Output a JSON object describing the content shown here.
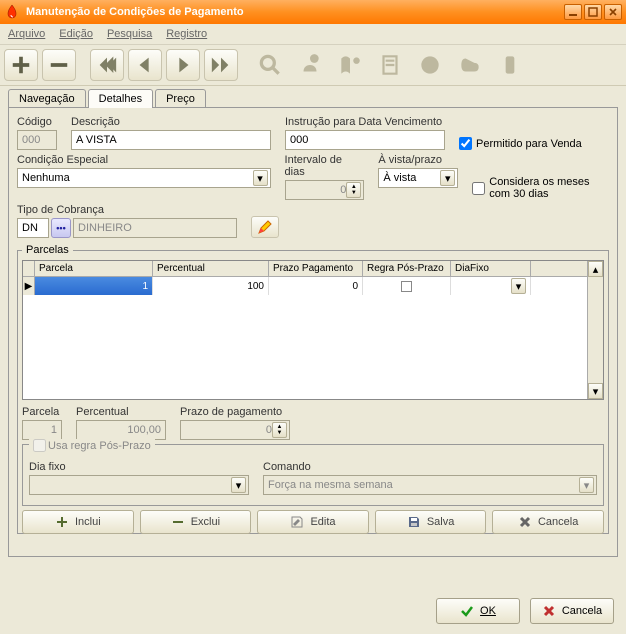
{
  "window": {
    "title": "Manutenção de Condições de Pagamento"
  },
  "menu": {
    "arquivo": "Arquivo",
    "edicao": "Edição",
    "pesquisa": "Pesquisa",
    "registro": "Registro"
  },
  "tabs": {
    "navegacao": "Navegação",
    "detalhes": "Detalhes",
    "preco": "Preço"
  },
  "labels": {
    "codigo": "Código",
    "descricao": "Descrição",
    "instrucao": "Instrução para Data Vencimento",
    "condicao": "Condição Especial",
    "intervalo": "Intervalo de dias",
    "avistaprazo": "À vista/prazo",
    "tipo_cobranca": "Tipo de Cobrança",
    "parcelas": "Parcelas",
    "parcela": "Parcela",
    "percentual": "Percentual",
    "prazo_pag": "Prazo de pagamento",
    "usa_regra": "Usa regra Pós-Prazo",
    "dia_fixo": "Dia fixo",
    "comando": "Comando",
    "permitido_venda": "Permitido para Venda",
    "considera_meses": "Considera os meses com 30 dias"
  },
  "values": {
    "codigo": "000",
    "descricao": "A VISTA",
    "instrucao": "000",
    "condicao": "Nenhuma",
    "intervalo": "0",
    "avistaprazo": "À vista",
    "tipo_cobranca_code": "DN",
    "tipo_cobranca_desc": "DINHEIRO",
    "comando": "Força na mesma semana",
    "parcela_num": "1",
    "parcela_pct": "100,00",
    "parcela_prazo": "0",
    "permitido_venda_checked": true,
    "considera_meses_checked": false
  },
  "grid": {
    "headers": {
      "parcela": "Parcela",
      "percentual": "Percentual",
      "prazo": "Prazo Pagamento",
      "regra": "Regra Pós-Prazo",
      "diafixo": "DiaFixo"
    },
    "row": {
      "parcela": "1",
      "percentual": "100",
      "prazo": "0"
    }
  },
  "buttons": {
    "inclui": "Inclui",
    "exclui": "Exclui",
    "edita": "Edita",
    "salva": "Salva",
    "cancela": "Cancela",
    "ok": "OK",
    "cancelar": "Cancela"
  },
  "chart_data": null
}
